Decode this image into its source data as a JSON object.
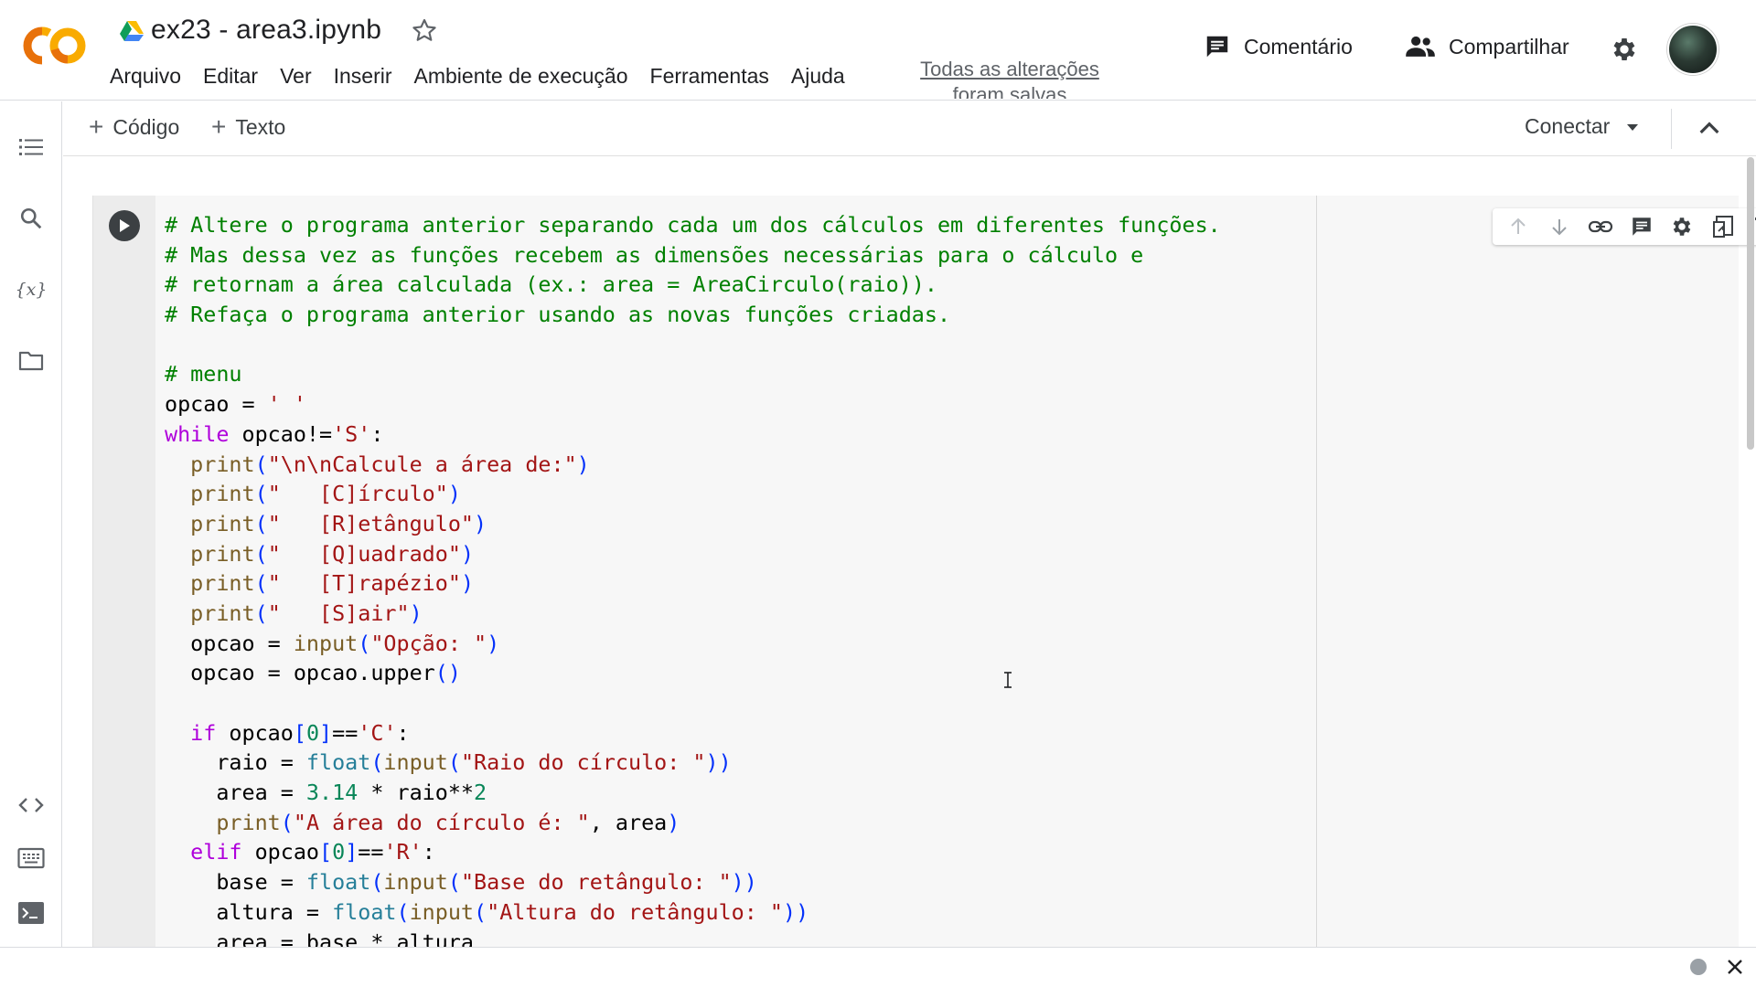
{
  "header": {
    "doc_title": "ex23 - area3.ipynb",
    "menu": [
      "Arquivo",
      "Editar",
      "Ver",
      "Inserir",
      "Ambiente de execução",
      "Ferramentas",
      "Ajuda"
    ],
    "save_status_line1": "Todas as alterações",
    "save_status_line2": "foram salvas",
    "comment_label": "Comentário",
    "share_label": "Compartilhar"
  },
  "toolbar": {
    "add_code_label": "Código",
    "add_text_label": "Texto",
    "connect_label": "Conectar"
  },
  "icons": {
    "logo": "colab-logo",
    "drive": "google-drive-icon",
    "star": "star-icon",
    "comment": "comment-icon",
    "share": "people-icon",
    "settings": "gear-icon",
    "rail": [
      "table-of-contents-icon",
      "search-icon",
      "variables-icon",
      "files-icon",
      "code-snippets-icon",
      "command-palette-icon",
      "terminal-icon"
    ],
    "cell_toolbar": [
      "move-up-icon",
      "move-down-icon",
      "link-icon",
      "comment-icon",
      "gear-icon",
      "mirror-cell-icon",
      "trash-icon",
      "more-vert-icon"
    ]
  },
  "colors": {
    "comment": "#008000",
    "keyword": "#af00db",
    "string": "#a31515",
    "function": "#795e26",
    "builtin": "#267f99",
    "number": "#098658",
    "bracket": "#0431fa",
    "logo_orange": "#f9ab00",
    "logo_dark_orange": "#e8710a"
  },
  "code_lines": [
    [
      [
        "c-com",
        "# Altere o programa anterior separando cada um dos cálculos em diferentes funções."
      ]
    ],
    [
      [
        "c-com",
        "# Mas dessa vez as funções recebem as dimensões necessárias para o cálculo e"
      ]
    ],
    [
      [
        "c-com",
        "# retornam a área calculada (ex.: area = AreaCirculo(raio))."
      ]
    ],
    [
      [
        "c-com",
        "# Refaça o programa anterior usando as novas funções criadas."
      ]
    ],
    [],
    [
      [
        "c-com",
        "# menu"
      ]
    ],
    [
      [
        "",
        "opcao = "
      ],
      [
        "c-str",
        "' '"
      ]
    ],
    [
      [
        "c-kw",
        "while"
      ],
      [
        "",
        " opcao!="
      ],
      [
        "c-str",
        "'S'"
      ],
      [
        "",
        ":"
      ]
    ],
    [
      [
        "",
        "  "
      ],
      [
        "c-fn",
        "print"
      ],
      [
        "c-br",
        "("
      ],
      [
        "c-str",
        "\"\\n\\nCalcule a área de:\""
      ],
      [
        "c-br",
        ")"
      ]
    ],
    [
      [
        "",
        "  "
      ],
      [
        "c-fn",
        "print"
      ],
      [
        "c-br",
        "("
      ],
      [
        "c-str",
        "\"   [C]írculo\""
      ],
      [
        "c-br",
        ")"
      ]
    ],
    [
      [
        "",
        "  "
      ],
      [
        "c-fn",
        "print"
      ],
      [
        "c-br",
        "("
      ],
      [
        "c-str",
        "\"   [R]etângulo\""
      ],
      [
        "c-br",
        ")"
      ]
    ],
    [
      [
        "",
        "  "
      ],
      [
        "c-fn",
        "print"
      ],
      [
        "c-br",
        "("
      ],
      [
        "c-str",
        "\"   [Q]uadrado\""
      ],
      [
        "c-br",
        ")"
      ]
    ],
    [
      [
        "",
        "  "
      ],
      [
        "c-fn",
        "print"
      ],
      [
        "c-br",
        "("
      ],
      [
        "c-str",
        "\"   [T]rapézio\""
      ],
      [
        "c-br",
        ")"
      ]
    ],
    [
      [
        "",
        "  "
      ],
      [
        "c-fn",
        "print"
      ],
      [
        "c-br",
        "("
      ],
      [
        "c-str",
        "\"   [S]air\""
      ],
      [
        "c-br",
        ")"
      ]
    ],
    [
      [
        "",
        "  opcao = "
      ],
      [
        "c-fn",
        "input"
      ],
      [
        "c-br",
        "("
      ],
      [
        "c-str",
        "\"Opção: \""
      ],
      [
        "c-br",
        ")"
      ]
    ],
    [
      [
        "",
        "  opcao = opcao.upper"
      ],
      [
        "c-br",
        "()"
      ]
    ],
    [],
    [
      [
        "",
        "  "
      ],
      [
        "c-kw",
        "if"
      ],
      [
        "",
        " opcao"
      ],
      [
        "c-br",
        "["
      ],
      [
        "c-num",
        "0"
      ],
      [
        "c-br",
        "]"
      ],
      [
        "",
        "=="
      ],
      [
        "c-str",
        "'C'"
      ],
      [
        "",
        ":"
      ]
    ],
    [
      [
        "",
        "    raio = "
      ],
      [
        "c-builtin",
        "float"
      ],
      [
        "c-br",
        "("
      ],
      [
        "c-fn",
        "input"
      ],
      [
        "c-br",
        "("
      ],
      [
        "c-str",
        "\"Raio do círculo: \""
      ],
      [
        "c-br",
        "))"
      ]
    ],
    [
      [
        "",
        "    area = "
      ],
      [
        "c-num",
        "3.14"
      ],
      [
        "",
        " * raio**"
      ],
      [
        "c-num",
        "2"
      ]
    ],
    [
      [
        "",
        "    "
      ],
      [
        "c-fn",
        "print"
      ],
      [
        "c-br",
        "("
      ],
      [
        "c-str",
        "\"A área do círculo é: \""
      ],
      [
        "",
        ", area"
      ],
      [
        "c-br",
        ")"
      ]
    ],
    [
      [
        "",
        "  "
      ],
      [
        "c-kw",
        "elif"
      ],
      [
        "",
        " opcao"
      ],
      [
        "c-br",
        "["
      ],
      [
        "c-num",
        "0"
      ],
      [
        "c-br",
        "]"
      ],
      [
        "",
        "=="
      ],
      [
        "c-str",
        "'R'"
      ],
      [
        "",
        ":"
      ]
    ],
    [
      [
        "",
        "    base = "
      ],
      [
        "c-builtin",
        "float"
      ],
      [
        "c-br",
        "("
      ],
      [
        "c-fn",
        "input"
      ],
      [
        "c-br",
        "("
      ],
      [
        "c-str",
        "\"Base do retângulo: \""
      ],
      [
        "c-br",
        "))"
      ]
    ],
    [
      [
        "",
        "    altura = "
      ],
      [
        "c-builtin",
        "float"
      ],
      [
        "c-br",
        "("
      ],
      [
        "c-fn",
        "input"
      ],
      [
        "c-br",
        "("
      ],
      [
        "c-str",
        "\"Altura do retângulo: \""
      ],
      [
        "c-br",
        "))"
      ]
    ],
    [
      [
        "",
        "    area = base * altura"
      ]
    ]
  ]
}
